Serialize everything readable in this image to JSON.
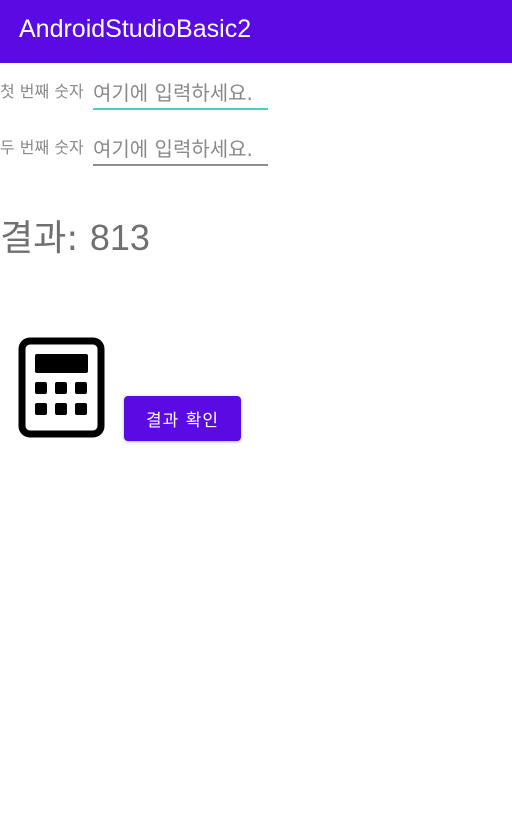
{
  "app_bar": {
    "title": "AndroidStudioBasic2",
    "color": "#5a0be3"
  },
  "form": {
    "first": {
      "label": "첫 번째 숫자",
      "value": "",
      "placeholder": "여기에 입력하세요."
    },
    "second": {
      "label": "두 번째 숫자",
      "value": "",
      "placeholder": "여기에 입력하세요."
    }
  },
  "result": {
    "label": "결과:",
    "value": "813"
  },
  "calculator_icon": "calculator-icon",
  "confirm_button": {
    "label": "결과 확인"
  },
  "colors": {
    "accent": "#5a0be3",
    "focus_underline": "#3fd6c6"
  }
}
